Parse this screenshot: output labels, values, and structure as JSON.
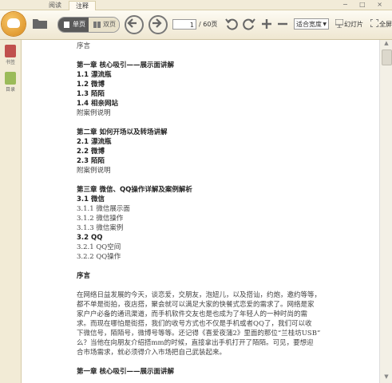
{
  "tabs": {
    "read": "阅读",
    "note": "注释"
  },
  "window_controls": "− □ ×",
  "toolbar": {
    "single_page": "单页",
    "double_page": "双页",
    "page_current": "1",
    "page_total": "/ 60页",
    "zoom": "适合宽度",
    "slideshow": "幻灯片",
    "fullscreen": "全屏"
  },
  "sidebar": {
    "bookmarks": "书签",
    "toc": "目录"
  },
  "document": {
    "preface": "序言",
    "ch1_title": "第一章 核心吸引——展示面讲解",
    "ch1_items": [
      "1.1 漂流瓶",
      "1.2 微博",
      "1.3 陌陌",
      "1.4 相亲网站"
    ],
    "ch1_appendix": "附案例说明",
    "ch2_title": "第二章 如何开场以及转场讲解",
    "ch2_items": [
      "2.1 漂流瓶",
      "2.2 微博",
      "2.3 陌陌"
    ],
    "ch2_appendix": "附案例说明",
    "ch3_title": "第三章 微信、QQ操作详解及案例解析",
    "ch3_items": [
      {
        "text": "3.1 微信",
        "bold": true
      },
      {
        "text": "3.1.1 微信展示面",
        "bold": false
      },
      {
        "text": "3.1.2 微信操作",
        "bold": false
      },
      {
        "text": "3.1.3 微信案例",
        "bold": false
      },
      {
        "text": "3.2 QQ",
        "bold": true
      },
      {
        "text": "3.2.1 QQ空间",
        "bold": false
      },
      {
        "text": "3.2.2 QQ操作",
        "bold": false
      }
    ],
    "preface_heading": "序言",
    "preface_lines": [
      "在网络日益发展的今天，谈恋爱，交朋友，泡妞儿，以及搭讪，约炮，邀约等等，",
      "都不单是街拍，夜店搭，聚会就可以满足大家的快餐式恋爱的需求了。网络是家",
      "家户户必备的通讯渠道，而手机软件交友也是也成为了年轻人的一种时尚的需",
      "求。而现在哪怕是街搭，我们的收号方式也不仅是手机或者QQ了，我们可以收",
      "下微信号，陌陌号，微博号等等。还记得《喜爱夜蒲2》里面的那位“兰桂坊USB”",
      "么？当他在向朋友介绍搭mm的时候，直接拿出手机打开了陌陌。可见，要想迎",
      "合市场需求，就必须得介入市场把自己武装起来。"
    ],
    "ch1_title_repeat": "第一章 核心吸引——展示面讲解"
  }
}
